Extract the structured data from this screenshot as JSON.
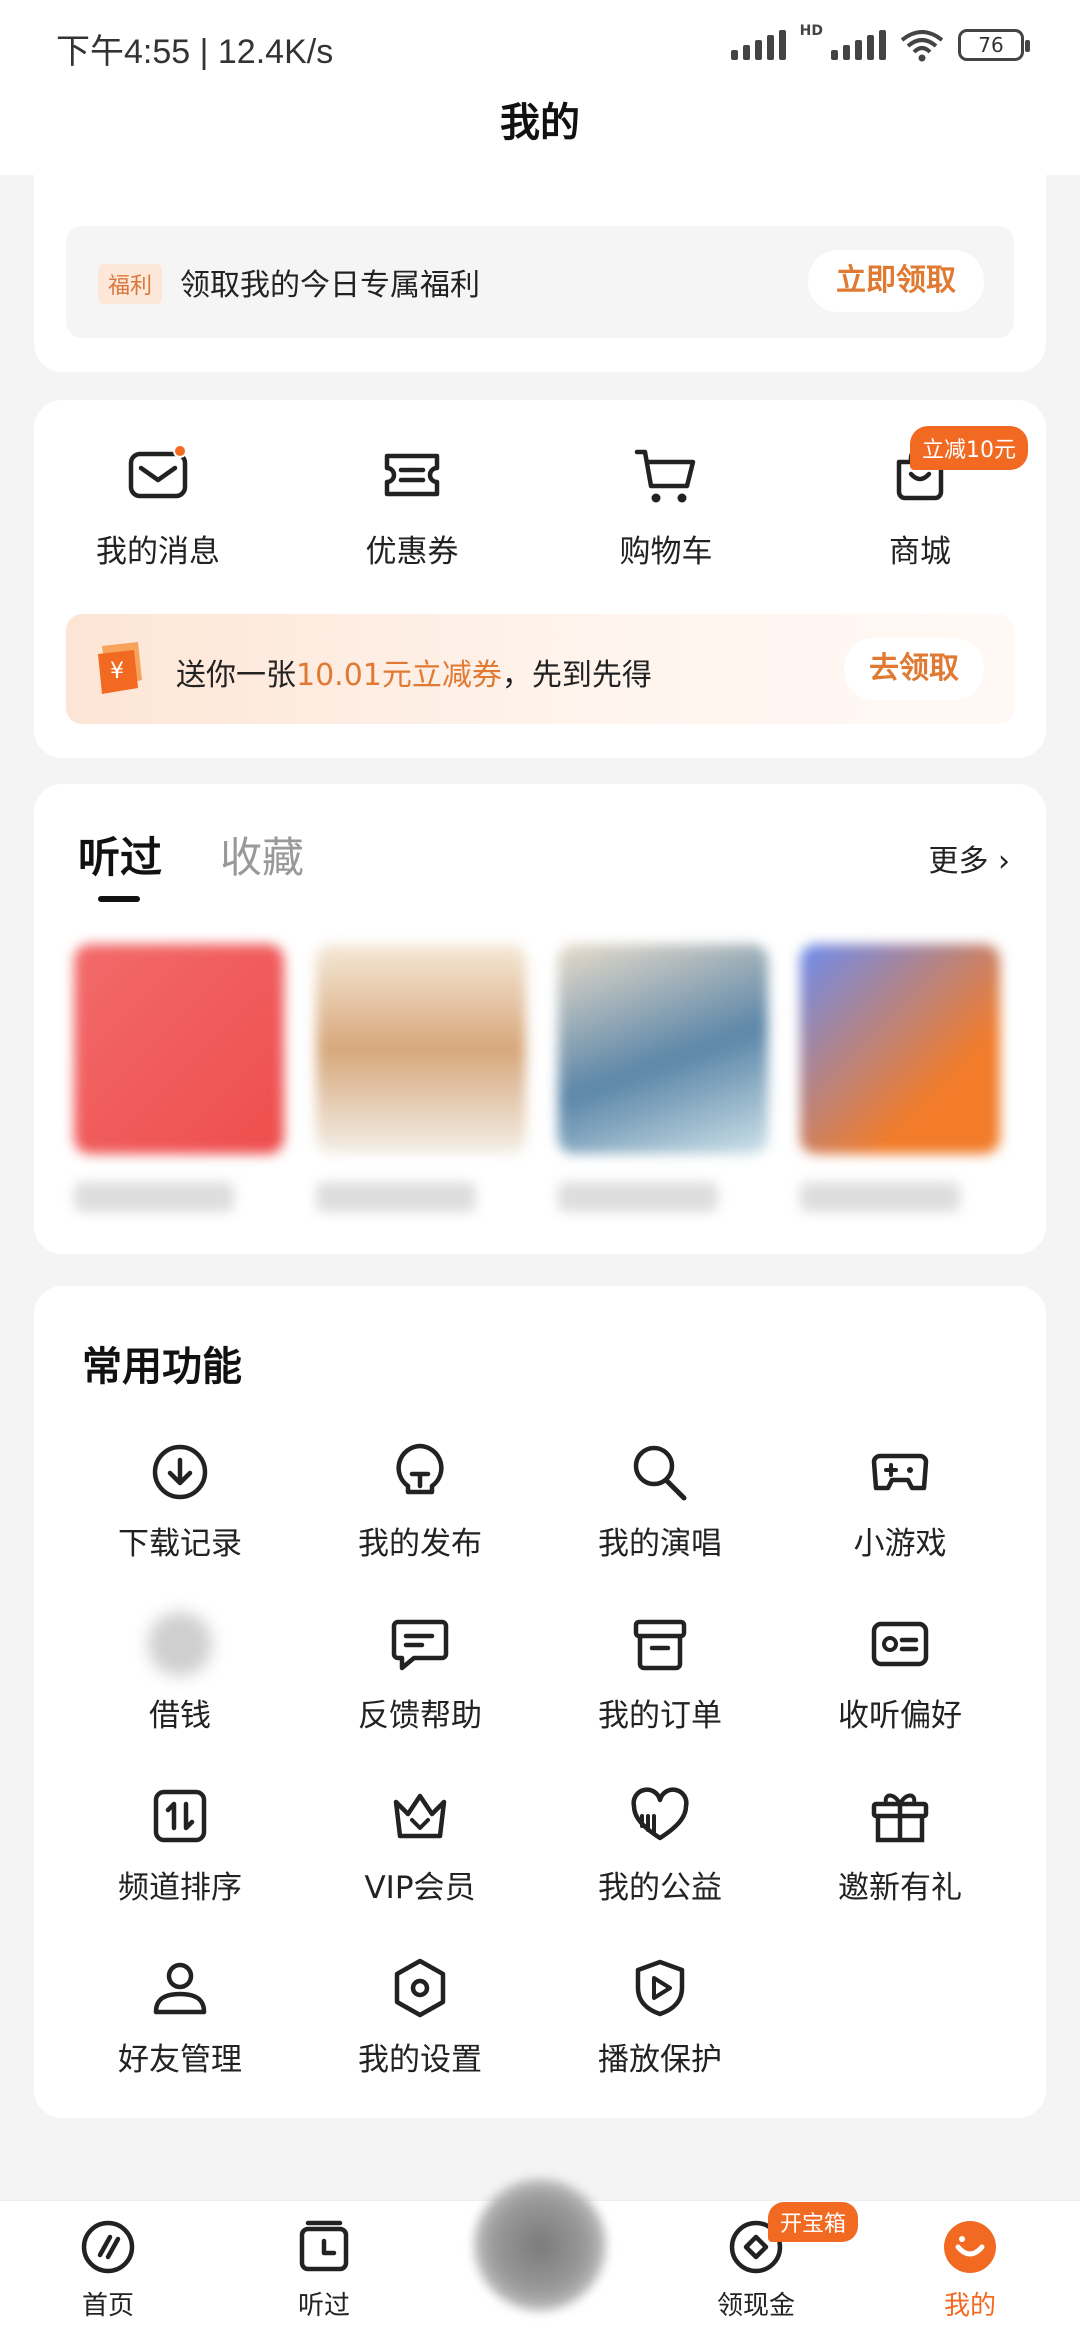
{
  "status_bar": {
    "time": "下午4:55 | 12.4K/s",
    "hd": "HD",
    "battery": "76"
  },
  "page": {
    "title": "我的"
  },
  "welfare": {
    "tag": "福利",
    "text": "领取我的今日专属福利",
    "button": "立即领取"
  },
  "quick": {
    "items": [
      {
        "label": "我的消息",
        "icon": "mail-icon"
      },
      {
        "label": "优惠券",
        "icon": "ticket-icon"
      },
      {
        "label": "购物车",
        "icon": "cart-icon"
      },
      {
        "label": "商城",
        "icon": "shopping-bag-icon"
      }
    ],
    "mall_badge": "立减10元"
  },
  "coupon": {
    "text_before": "送你一张",
    "highlight": "10.01元立减券",
    "text_after": "，先到先得",
    "button": "去领取"
  },
  "history": {
    "tab_active": "听过",
    "tab_inactive": "收藏",
    "more": "更多"
  },
  "functions": {
    "title": "常用功能",
    "items": [
      {
        "label": "下载记录",
        "icon": "download-icon"
      },
      {
        "label": "我的发布",
        "icon": "lightbulb-icon"
      },
      {
        "label": "我的演唱",
        "icon": "microphone-icon"
      },
      {
        "label": "小游戏",
        "icon": "gamepad-icon"
      },
      {
        "label": "借钱",
        "icon": "loan-icon"
      },
      {
        "label": "反馈帮助",
        "icon": "feedback-icon"
      },
      {
        "label": "我的订单",
        "icon": "order-box-icon"
      },
      {
        "label": "收听偏好",
        "icon": "preference-card-icon"
      },
      {
        "label": "频道排序",
        "icon": "sort-icon"
      },
      {
        "label": "VIP会员",
        "icon": "crown-icon"
      },
      {
        "label": "我的公益",
        "icon": "charity-heart-icon"
      },
      {
        "label": "邀新有礼",
        "icon": "gift-icon"
      },
      {
        "label": "好友管理",
        "icon": "user-icon"
      },
      {
        "label": "我的设置",
        "icon": "settings-icon"
      },
      {
        "label": "播放保护",
        "icon": "play-shield-icon"
      }
    ]
  },
  "bottom_nav": {
    "items": [
      {
        "label": "首页",
        "icon": "home-icon"
      },
      {
        "label": "听过",
        "icon": "history-icon"
      },
      {
        "label": "领现金",
        "icon": "cash-icon"
      },
      {
        "label": "我的",
        "icon": "profile-icon"
      }
    ],
    "treasure_badge": "开宝箱",
    "active": "我的"
  }
}
